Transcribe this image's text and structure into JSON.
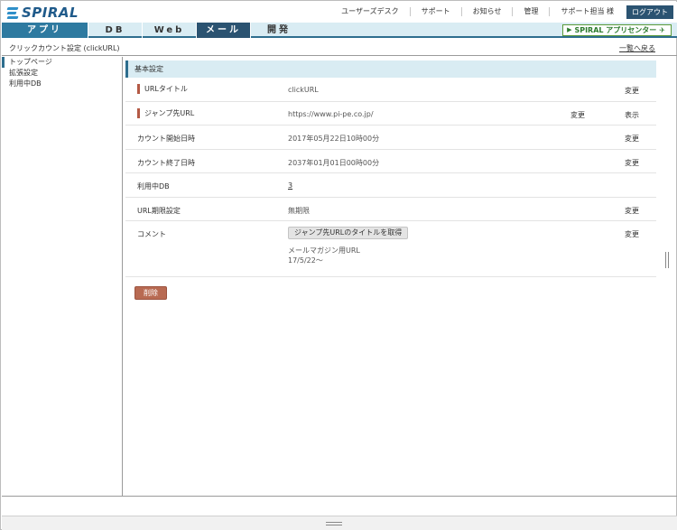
{
  "brand": {
    "logo_text": "SPIRAL",
    "accent": "#2e6e8e",
    "tab_active": "#2e7aa0"
  },
  "toplinks": [
    "ユーザーズデスク",
    "サポート",
    "お知らせ",
    "管理",
    "サポート担当 様"
  ],
  "logout_label": "ログアウト",
  "tabs": [
    "アプリ",
    "DB",
    "Web",
    "メール",
    "開発"
  ],
  "app_center_label": "SPIRAL アプリセンター",
  "page_title": "クリックカウント設定 (clickURL)",
  "back_link": "一覧へ戻る",
  "sidebar": {
    "items": [
      {
        "label": "トップページ",
        "active": true
      },
      {
        "label": "拡張設定",
        "active": false
      },
      {
        "label": "利用中DB",
        "active": false
      }
    ]
  },
  "section_title": "基本設定",
  "rows": [
    {
      "label": "URLタイトル",
      "value": "clickURL",
      "action1": "",
      "action2": "変更"
    },
    {
      "label": "ジャンプ先URL",
      "value": "https://www.pi-pe.co.jp/",
      "action1": "変更",
      "action2": "表示"
    },
    {
      "label": "カウント開始日時",
      "value": "2017年05月22日10時00分",
      "action1": "",
      "action2": "変更"
    },
    {
      "label": "カウント終了日時",
      "value": "2037年01月01日00時00分",
      "action1": "",
      "action2": "変更"
    },
    {
      "label": "利用中DB",
      "value": "3",
      "action1": "",
      "action2": ""
    },
    {
      "label": "URL期限設定",
      "value": "無期限",
      "action1": "",
      "action2": "変更"
    }
  ],
  "comment": {
    "label": "コメント",
    "fetch_button": "ジャンプ先URLのタイトルを取得",
    "text": "メールマガジン用URL\n17/5/22～",
    "action": "変更"
  },
  "delete_button": "削除"
}
